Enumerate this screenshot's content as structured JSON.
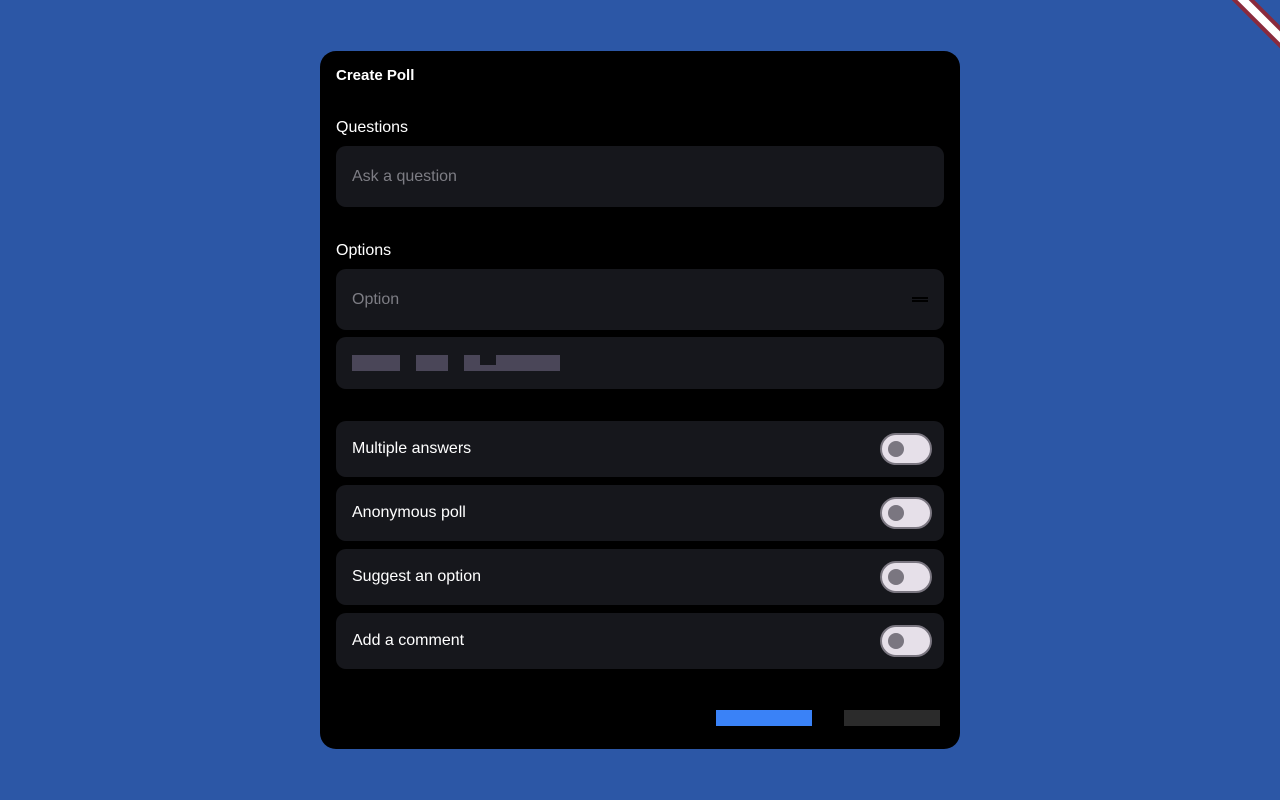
{
  "dialog": {
    "title": "Create Poll",
    "questions_label": "Questions",
    "question_placeholder": "Ask a question",
    "options_label": "Options",
    "option_placeholder": "Option"
  },
  "toggles": [
    {
      "label": "Multiple answers",
      "on": false
    },
    {
      "label": "Anonymous poll",
      "on": false
    },
    {
      "label": "Suggest an option",
      "on": false
    },
    {
      "label": "Add a comment",
      "on": false
    }
  ],
  "colors": {
    "background": "#2c57a6",
    "dialog": "#000000",
    "field": "#16171c",
    "primary_button": "#3a82f7",
    "secondary_button": "#2b2b2b",
    "switch_track": "#e6e0e9",
    "switch_thumb": "#7a7680"
  }
}
